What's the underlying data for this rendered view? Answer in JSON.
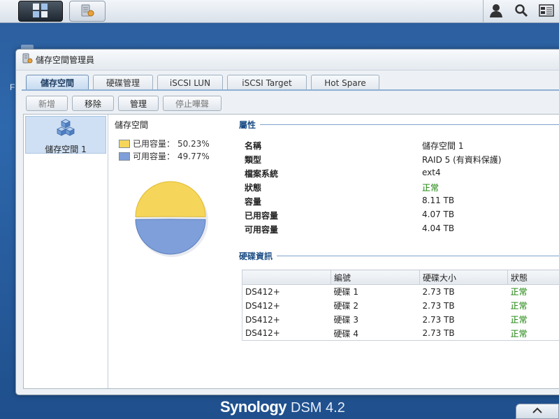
{
  "taskbar": {
    "main_icon": "grid-icon",
    "app_icon": "storage-manager-icon",
    "right_icons": [
      "user-icon",
      "search-icon",
      "widgets-icon"
    ]
  },
  "desktop": {
    "edge_letter": "F"
  },
  "window": {
    "title": "儲存空間管理員",
    "tabs": [
      "儲存空間",
      "硬碟管理",
      "iSCSI LUN",
      "iSCSI Target",
      "Hot Spare"
    ],
    "active_tab": 0,
    "toolbar": {
      "create": "新增",
      "remove": "移除",
      "manage": "管理",
      "stop_beep": "停止嗶聲"
    }
  },
  "volumes": [
    {
      "label": "儲存空間 1"
    }
  ],
  "usage": {
    "title": "儲存空間",
    "used_label": "已用容量：",
    "used_pct": "50.23%",
    "free_label": "可用容量：",
    "free_pct": "49.77%",
    "used_fraction": 0.5023,
    "used_color": "#f5d65a",
    "free_color": "#7f9fda"
  },
  "properties": {
    "heading": "屬性",
    "rows": [
      {
        "key": "名稱",
        "value": "儲存空間 1"
      },
      {
        "key": "類型",
        "value": "RAID 5 (有資料保護)"
      },
      {
        "key": "檔案系統",
        "value": "ext4"
      },
      {
        "key": "狀態",
        "value": "正常"
      },
      {
        "key": "容量",
        "value": "8.11 TB"
      },
      {
        "key": "已用容量",
        "value": "4.07 TB"
      },
      {
        "key": "可用容量",
        "value": "4.04 TB"
      }
    ]
  },
  "disks": {
    "heading": "硬碟資訊",
    "headers": [
      "",
      "編號",
      "硬碟大小",
      "狀態"
    ],
    "rows": [
      [
        "DS412+",
        "硬碟 1",
        "2.73 TB",
        "正常"
      ],
      [
        "DS412+",
        "硬碟 2",
        "2.73 TB",
        "正常"
      ],
      [
        "DS412+",
        "硬碟 3",
        "2.73 TB",
        "正常"
      ],
      [
        "DS412+",
        "硬碟 4",
        "2.73 TB",
        "正常"
      ]
    ]
  },
  "footer": {
    "brand": "Synology",
    "version": "DSM 4.2",
    "corner_icon": "chevron-up-icon"
  }
}
